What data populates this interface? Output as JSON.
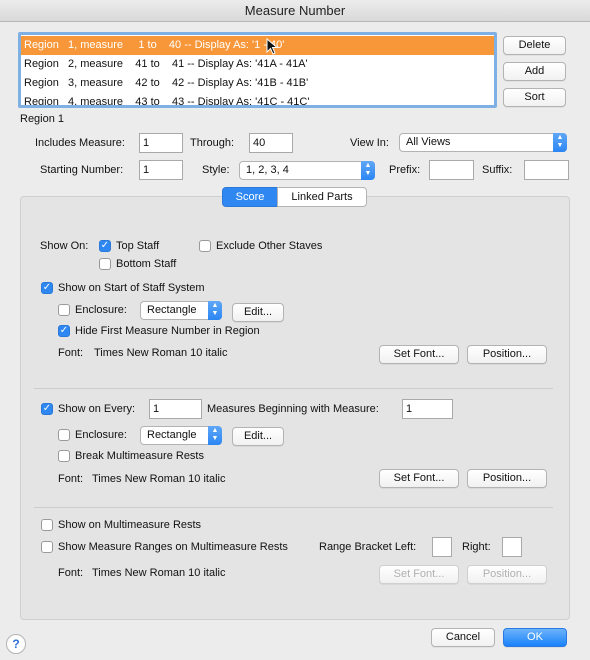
{
  "window": {
    "title": "Measure Number"
  },
  "regions": [
    "Region   1, measure     1 to    40 -- Display As: '1 - 40'",
    "Region   2, measure    41 to    41 -- Display As: '41A - 41A'",
    "Region   3, measure    42 to    42 -- Display As: '41B - 41B'",
    "Region   4, measure    43 to    43 -- Display As: '41C - 41C'"
  ],
  "region_buttons": {
    "delete": "Delete",
    "add": "Add",
    "sort": "Sort"
  },
  "region_header": "Region 1",
  "region_settings": {
    "includes_label": "Includes Measure:",
    "includes_value": "1",
    "through_label": "Through:",
    "through_value": "40",
    "view_in_label": "View In:",
    "view_in_value": "All Views",
    "starting_label": "Starting Number:",
    "starting_value": "1",
    "style_label": "Style:",
    "style_value": "1, 2, 3, 4",
    "prefix_label": "Prefix:",
    "prefix_value": "",
    "suffix_label": "Suffix:",
    "suffix_value": ""
  },
  "tabs": [
    "Score",
    "Linked Parts"
  ],
  "show_on": {
    "label": "Show On:",
    "top_staff": "Top Staff",
    "top_staff_checked": true,
    "exclude_other": "Exclude Other Staves",
    "exclude_other_checked": false,
    "bottom_staff": "Bottom Staff",
    "bottom_staff_checked": false
  },
  "start_system": {
    "show_label": "Show on Start of Staff System",
    "show_checked": true,
    "enclosure_label": "Enclosure:",
    "enclosure_checked": false,
    "enclosure_value": "Rectangle",
    "edit": "Edit...",
    "hide_first_label": "Hide First Measure Number in Region",
    "hide_first_checked": true,
    "font_label": "Font:",
    "font_value": "Times New Roman 10  italic",
    "set_font": "Set Font...",
    "position": "Position..."
  },
  "every": {
    "show_label": "Show on Every:",
    "show_checked": true,
    "every_value": "1",
    "beginning_label": "Measures Beginning with Measure:",
    "beginning_value": "1",
    "enclosure_label": "Enclosure:",
    "enclosure_checked": false,
    "enclosure_value": "Rectangle",
    "edit": "Edit...",
    "break_label": "Break Multimeasure Rests",
    "break_checked": false,
    "font_label": "Font:",
    "font_value": "Times New Roman 10  italic",
    "set_font": "Set Font...",
    "position": "Position..."
  },
  "multimeasure": {
    "show_label": "Show on Multimeasure Rests",
    "show_checked": false,
    "ranges_label": "Show Measure Ranges on Multimeasure Rests",
    "ranges_checked": false,
    "bracket_left_label": "Range Bracket Left:",
    "bracket_left_value": "",
    "right_label": "Right:",
    "right_value": "",
    "font_label": "Font:",
    "font_value": "Times New Roman 10  italic",
    "set_font": "Set Font...",
    "position": "Position..."
  },
  "footer": {
    "help": "?",
    "cancel": "Cancel",
    "ok": "OK"
  }
}
